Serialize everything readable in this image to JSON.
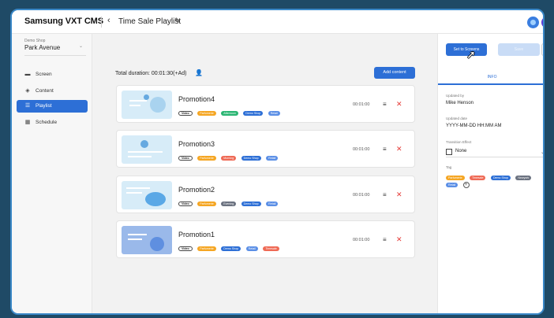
{
  "header": {
    "brand": "Samsung VXT CMS",
    "back_glyph": "‹",
    "title": "Time Sale Playlist",
    "icons": [
      "pencil-icon",
      "notification-icon",
      "user-avatar-icon"
    ]
  },
  "sidebar": {
    "store_caption": "Demo Shop",
    "store_name": "Park Avenue",
    "items": [
      {
        "label": "Screen",
        "icon": "screen-icon"
      },
      {
        "label": "Content",
        "icon": "content-icon"
      },
      {
        "label": "Playlist",
        "icon": "playlist-icon",
        "active": true
      },
      {
        "label": "Schedule",
        "icon": "schedule-icon"
      }
    ]
  },
  "main": {
    "total_duration": "Total duration: 00:01:30(+Ad)",
    "add_content_label": "Add content",
    "items": [
      {
        "name": "Promotion4",
        "duration": "00:01:00",
        "tags": [
          "Video",
          "Parfumerie",
          "Afternoon",
          "Demo Shop",
          "Retail"
        ]
      },
      {
        "name": "Promotion3",
        "duration": "00:01:00",
        "tags": [
          "Video",
          "Parfumerie",
          "Morning",
          "Demo Shop",
          "Retail"
        ]
      },
      {
        "name": "Promotion2",
        "duration": "00:01:00",
        "tags": [
          "Video",
          "Parfumerie",
          "Evening",
          "Demo Shop",
          "Retail"
        ]
      },
      {
        "name": "Promotion1",
        "duration": "00:01:00",
        "tags": [
          "Video",
          "Parfumerie",
          "Demo Shop",
          "Retail",
          "Timesale"
        ]
      }
    ]
  },
  "right_panel": {
    "set_button_label": "Set to Screens",
    "save_button_label": "Save",
    "more_glyph": "⋮",
    "info_tab": "INFO",
    "updated_by_label": "Updated by",
    "updated_by_value": "Mike Henson",
    "updated_date_label": "Updated date",
    "updated_date_value": "YYYY-MM-DD HH:MM AM",
    "transition_label": "Transition Effect",
    "transition_value": "None",
    "tag_label": "Tag",
    "tags": [
      "Parfumerie",
      "Timesale",
      "Demo Shop",
      "Newyork",
      "Retail"
    ]
  },
  "colors": {
    "accent": "#2d6fd6",
    "tag_orange": "#f5a623",
    "tag_green": "#2bb673",
    "tag_red": "#ef6a55",
    "tag_blue": "#2d6fd6",
    "tag_blue_light": "#5b8fe6",
    "tag_gray": "#6b7280"
  }
}
